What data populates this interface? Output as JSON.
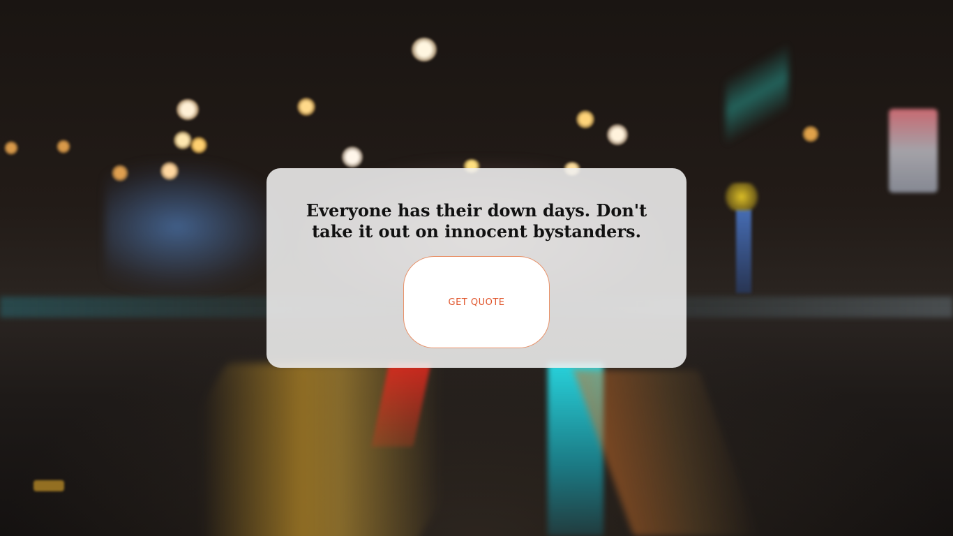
{
  "background": {
    "description_icon": "night-street-background"
  },
  "quote": {
    "text": "Everyone has their down days. Don't take it out on innocent bystanders."
  },
  "button": {
    "label": "GET QUOTE"
  },
  "colors": {
    "card_bg": "#f0f0f0",
    "quote_text": "#111111",
    "button_text": "#e0542a",
    "button_border": "#e8926a"
  }
}
